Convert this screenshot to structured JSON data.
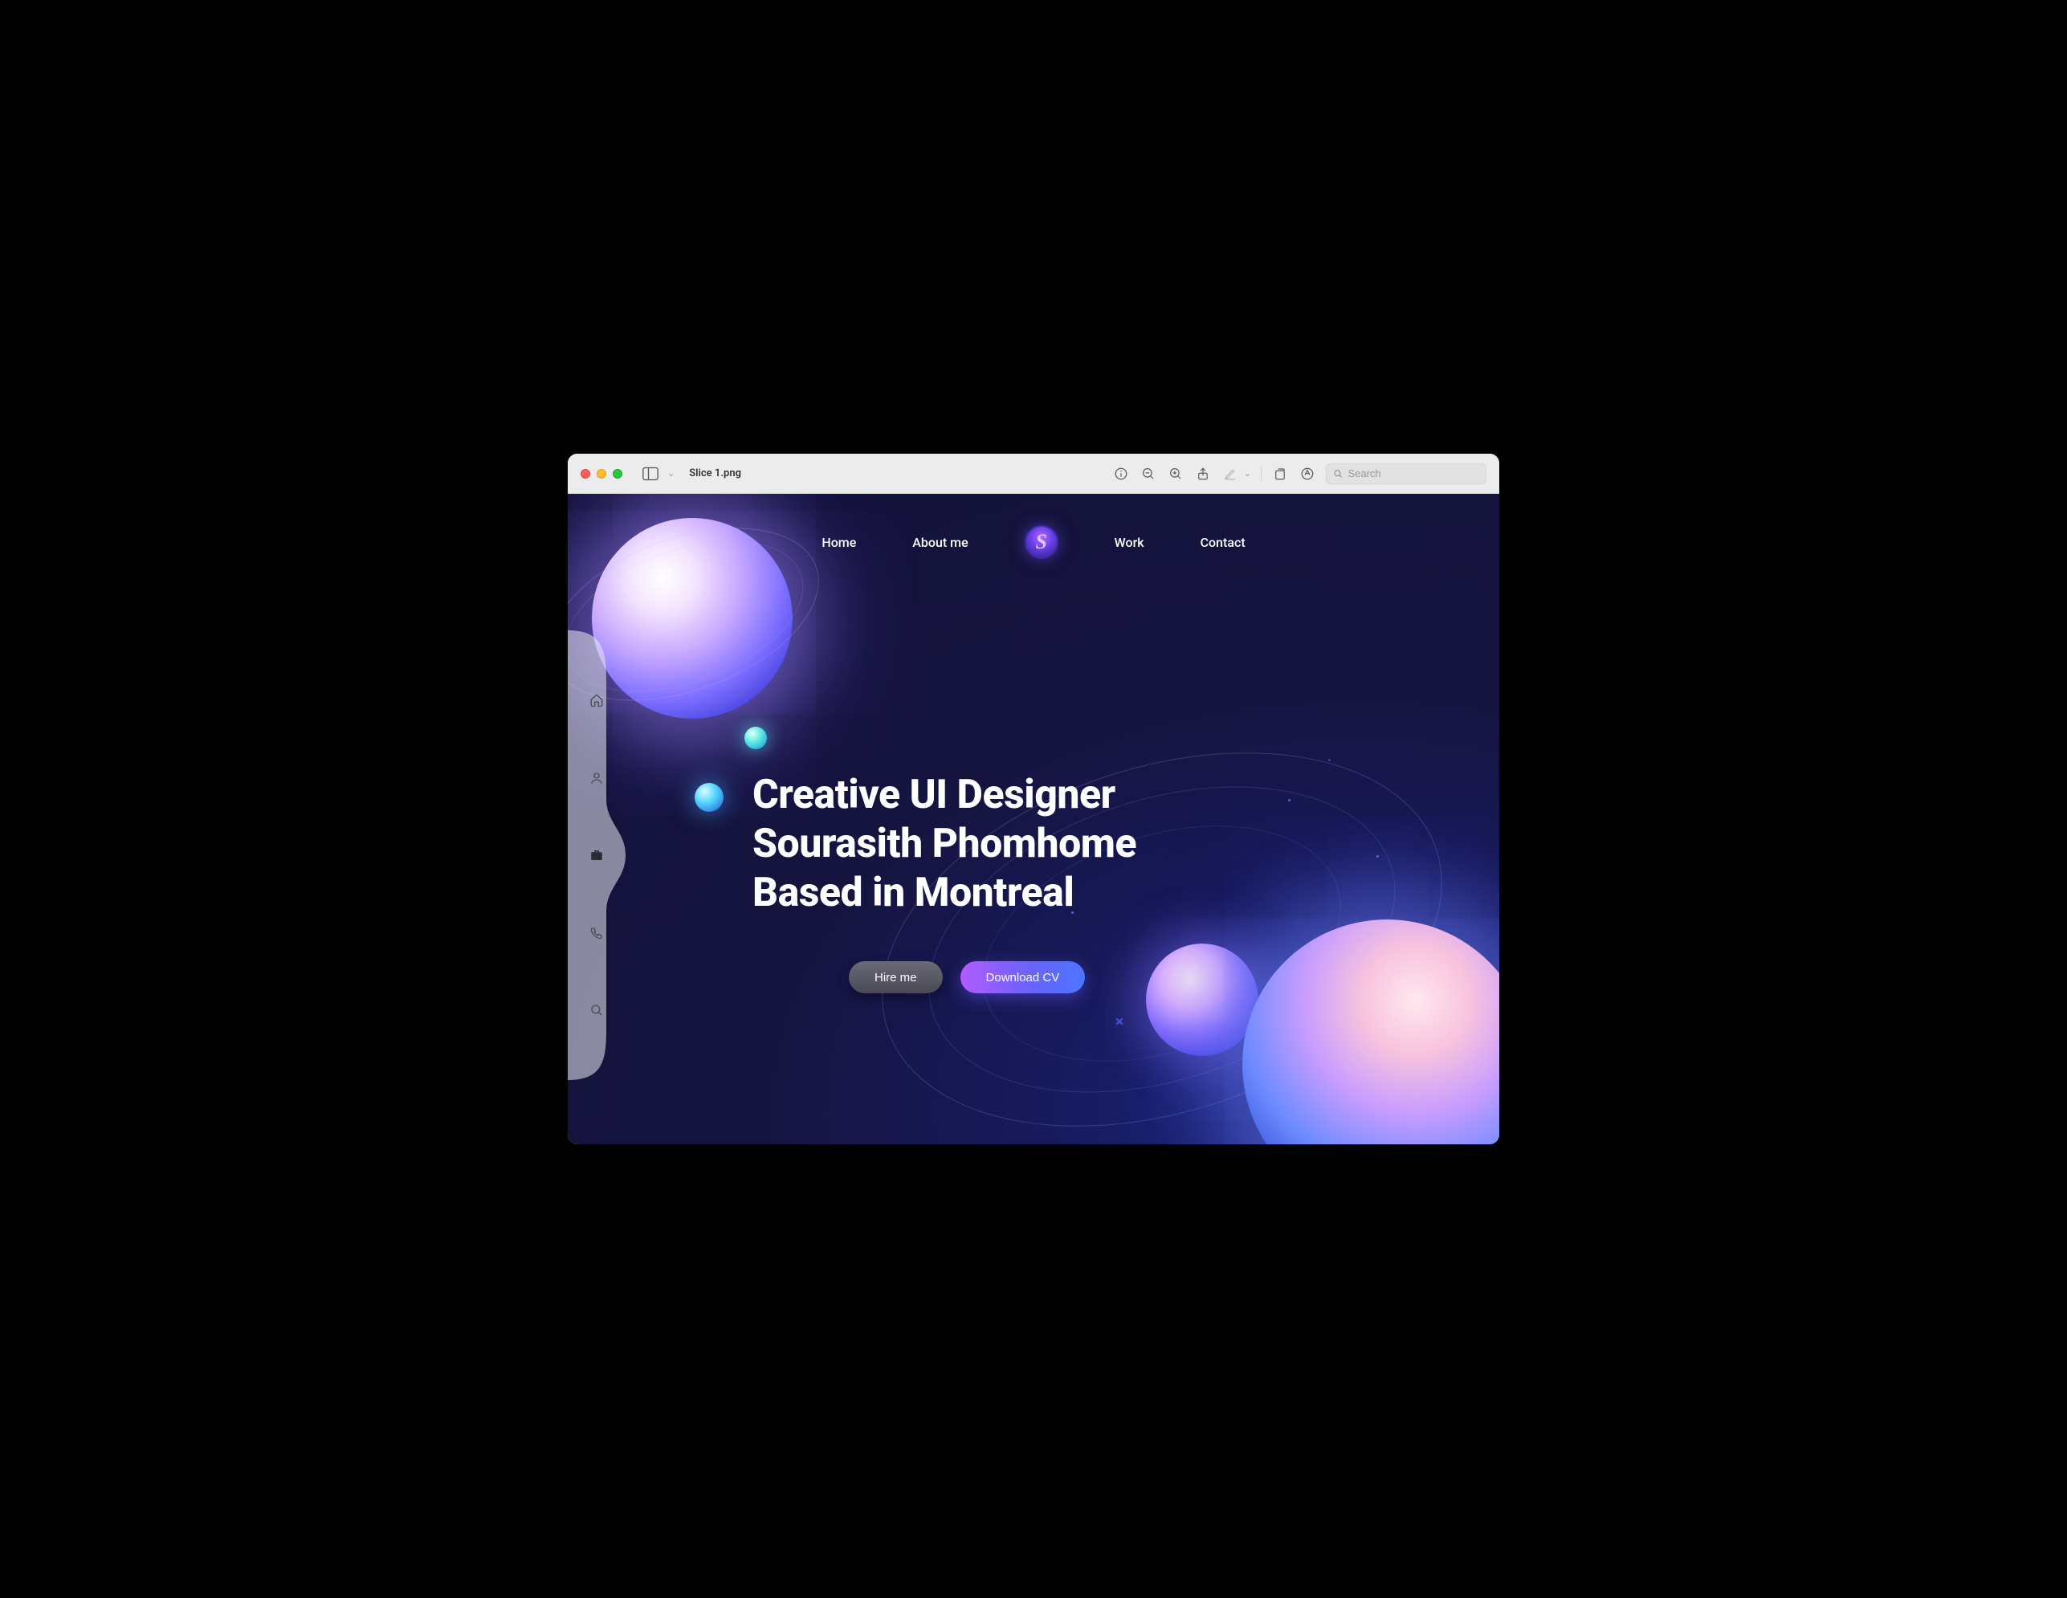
{
  "window": {
    "filename": "Slice 1.png",
    "search_placeholder": "Search"
  },
  "nav": {
    "items": [
      {
        "label": "Home"
      },
      {
        "label": "About me"
      },
      {
        "label": "Work"
      },
      {
        "label": "Contact"
      }
    ],
    "logo_letter": "S"
  },
  "sidebar": {
    "items": [
      {
        "name": "home"
      },
      {
        "name": "profile"
      },
      {
        "name": "work",
        "active": true
      },
      {
        "name": "contact"
      },
      {
        "name": "search"
      }
    ]
  },
  "hero": {
    "line1": "Creative UI Designer",
    "line2": "Sourasith Phomhome",
    "line3": "Based in Montreal"
  },
  "cta": {
    "hire_label": "Hire me",
    "download_label": "Download CV"
  }
}
